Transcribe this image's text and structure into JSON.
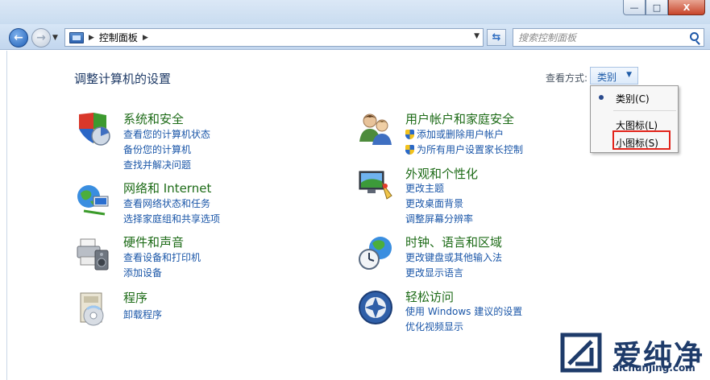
{
  "window": {
    "minimize_glyph": "—",
    "maximize_glyph": "□",
    "close_glyph": "X"
  },
  "nav": {
    "back_icon": "arrow-left-icon",
    "forward_icon": "arrow-right-icon",
    "breadcrumb": [
      "控制面板"
    ],
    "search_placeholder": "搜索控制面板"
  },
  "header": {
    "title": "调整计算机的设置",
    "view_by_label": "查看方式:",
    "view_by_value": "类别"
  },
  "view_menu": {
    "items": [
      {
        "label": "类别(C)",
        "checked": true
      },
      {
        "label": "大图标(L)",
        "checked": false
      },
      {
        "label": "小图标(S)",
        "checked": false
      }
    ]
  },
  "categories": {
    "system_security": {
      "title": "系统和安全",
      "icon": "shield-chart-icon",
      "links": [
        "查看您的计算机状态",
        "备份您的计算机",
        "查找并解决问题"
      ]
    },
    "network": {
      "title": "网络和 Internet",
      "icon": "globe-network-icon",
      "links": [
        "查看网络状态和任务",
        "选择家庭组和共享选项"
      ]
    },
    "hardware": {
      "title": "硬件和声音",
      "icon": "printer-speaker-icon",
      "links": [
        "查看设备和打印机",
        "添加设备"
      ]
    },
    "programs": {
      "title": "程序",
      "icon": "programs-disc-icon",
      "links": [
        "卸载程序"
      ]
    },
    "user_accounts": {
      "title": "用户帐户和家庭安全",
      "icon": "users-icon",
      "links": [
        "添加或删除用户帐户",
        "为所有用户设置家长控制"
      ]
    },
    "appearance": {
      "title": "外观和个性化",
      "icon": "monitor-palette-icon",
      "links": [
        "更改主题",
        "更改桌面背景",
        "调整屏幕分辨率"
      ]
    },
    "clock_region": {
      "title": "时钟、语言和区域",
      "icon": "clock-globe-icon",
      "links": [
        "更改键盘或其他输入法",
        "更改显示语言"
      ]
    },
    "ease_access": {
      "title": "轻松访问",
      "icon": "ease-of-access-icon",
      "links": [
        "使用 Windows 建议的设置",
        "优化视频显示"
      ]
    }
  },
  "watermark": {
    "text": "爱纯净",
    "url": "aichunjing.com"
  },
  "colors": {
    "category_title": "#1d6b17",
    "link": "#1a56a8",
    "highlight": "#e2231a"
  }
}
